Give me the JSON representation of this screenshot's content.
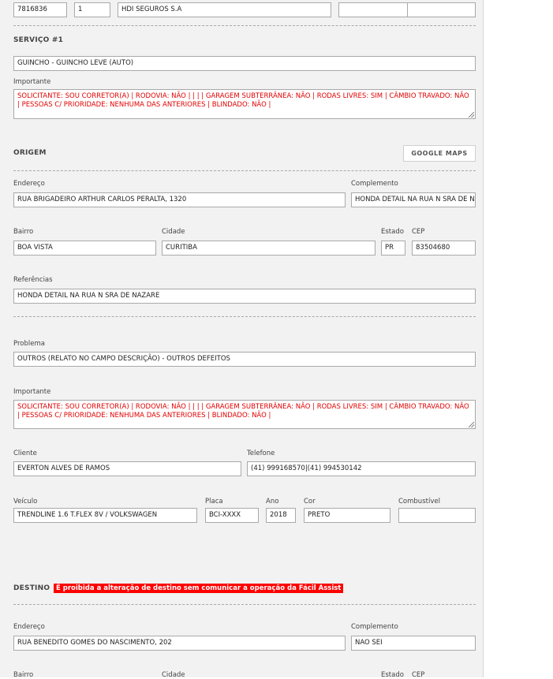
{
  "top": {
    "field1": "7816836",
    "field2": "1",
    "insurer": "HDI SEGUROS S.A",
    "field4": "",
    "field5": ""
  },
  "service": {
    "title": "SERVIÇO #1",
    "type": "GUINCHO - GUINCHO LEVE (AUTO)",
    "important_label": "Importante",
    "important_text": "SOLICITANTE: SOU CORRETOR(A) | RODOVIA: NÃO |  |  |  | GARAGEM SUBTERRÂNEA: NÃO | RODAS LIVRES: SIM | CÂMBIO TRAVADO: NÃO | PESSOAS C/ PRIORIDADE: NENHUMA DAS ANTERIORES | BLINDADO: NÃO |"
  },
  "origin": {
    "title": "ORIGEM",
    "maps_button": "GOOGLE MAPS",
    "address_label": "Endereço",
    "address": "RUA BRIGADEIRO ARTHUR CARLOS PERALTA, 1320",
    "complement_label": "Complemento",
    "complement": "HONDA DETAIL NA RUA N SRA DE NA",
    "district_label": "Bairro",
    "district": "BOA VISTA",
    "city_label": "Cidade",
    "city": "CURITIBA",
    "state_label": "Estado",
    "state": "PR",
    "zip_label": "CEP",
    "zip": "83504680",
    "references_label": "Referências",
    "references": "HONDA DETAIL NA RUA N SRA DE NAZARE"
  },
  "problem": {
    "label": "Problema",
    "value": "OUTROS (RELATO NO CAMPO DESCRIÇÃO) - OUTROS DEFEITOS",
    "important_label": "Importante",
    "important_text": "SOLICITANTE: SOU CORRETOR(A) | RODOVIA: NÃO |  |  |  | GARAGEM SUBTERRÂNEA: NÃO | RODAS LIVRES: SIM | CÂMBIO TRAVADO: NÃO | PESSOAS C/ PRIORIDADE: NENHUMA DAS ANTERIORES | BLINDADO: NÃO |"
  },
  "client": {
    "label": "Cliente",
    "value": "EVERTON ALVES DE RAMOS",
    "phone_label": "Telefone",
    "phone": "(41) 999168570|(41) 994530142"
  },
  "vehicle": {
    "label": "Veículo",
    "value": "TRENDLINE 1.6 T.FLEX 8V / VOLKSWAGEN",
    "plate_label": "Placa",
    "plate": "BCI-XXXX",
    "year_label": "Ano",
    "year": "2018",
    "color_label": "Cor",
    "color": "PRETO",
    "fuel_label": "Combustível",
    "fuel": ""
  },
  "destination": {
    "title": "DESTINO",
    "warning": "É proibida a alteração de destino sem comunicar a operação da Fácil Assist",
    "address_label": "Endereço",
    "address": "RUA BENEDITO GOMES DO NASCIMENTO, 202",
    "complement_label": "Complemento",
    "complement": "NAO SEI",
    "district_label": "Bairro",
    "city_label": "Cidade",
    "state_label": "Estado",
    "zip_label": "CEP"
  },
  "colors": {
    "panel_bg": "#f2f2f2",
    "warning_bg": "#ff0000",
    "important_text": "#e00000"
  }
}
